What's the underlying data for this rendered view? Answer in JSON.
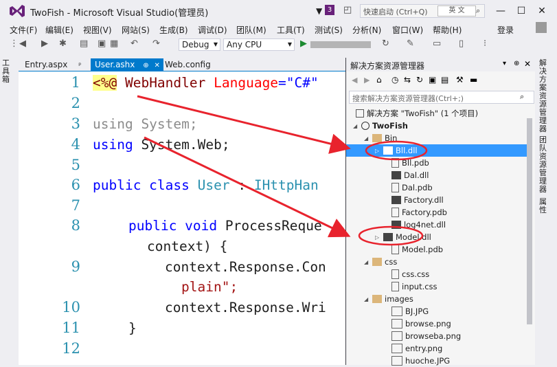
{
  "window": {
    "title": "TwoFish - Microsoft Visual Studio(管理员)",
    "notification_count": "3",
    "quick_launch_placeholder": "快速启动 (Ctrl+Q)",
    "ime_indicator": "英 文",
    "login_label": "登录"
  },
  "menu": [
    "文件(F)",
    "编辑(E)",
    "视图(V)",
    "网站(S)",
    "生成(B)",
    "调试(D)",
    "团队(M)",
    "工具(T)",
    "测试(S)",
    "分析(N)",
    "窗口(W)",
    "帮助(H)"
  ],
  "toolbar": {
    "configuration": "Debug",
    "platform": "Any CPU"
  },
  "toolbox_label": "工具箱",
  "editor": {
    "tabs": [
      {
        "label": "Entry.aspx",
        "pin": "ᵖ"
      },
      {
        "label": "User.ashx",
        "pin": "⊕",
        "close": "✕"
      },
      {
        "label": "Web.config"
      }
    ],
    "lines": [
      {
        "n": "1"
      },
      {
        "n": "2"
      },
      {
        "n": "3"
      },
      {
        "n": "4"
      },
      {
        "n": "5"
      },
      {
        "n": "6"
      },
      {
        "n": "7"
      },
      {
        "n": "8"
      },
      {
        "n": "9"
      },
      {
        "n": "10"
      },
      {
        "n": "11"
      },
      {
        "n": "12"
      }
    ],
    "code": {
      "l1_dir": "<%@",
      "l1_name": " WebHandler ",
      "l1_attr": "Language",
      "l1_eq": "=",
      "l1_val": "\"C#\"",
      "l3": "using System;",
      "l4a": "using",
      "l4b": " System.Web;",
      "l6a": "public class",
      "l6b": " User",
      "l6c": " : ",
      "l6d": "IHttpHan",
      "l8a": "public void",
      "l8b": " ProcessReque",
      "l8c": "context) {",
      "l9a": "context.Response.Con",
      "l9b": "plain\";",
      "l10": "context.Response.Wri",
      "l11": "}"
    }
  },
  "solution_explorer": {
    "title": "解决方案资源管理器",
    "search_placeholder": "搜索解决方案资源管理器(Ctrl+;)",
    "items": [
      {
        "label": "解决方案 \"TwoFish\" (1 个项目)"
      },
      {
        "label": "TwoFish"
      },
      {
        "label": "Bin"
      },
      {
        "label": "Bll.dll"
      },
      {
        "label": "Bll.pdb"
      },
      {
        "label": "Dal.dll"
      },
      {
        "label": "Dal.pdb"
      },
      {
        "label": "Factory.dll"
      },
      {
        "label": "Factory.pdb"
      },
      {
        "label": "log4net.dll"
      },
      {
        "label": "Model.dll"
      },
      {
        "label": "Model.pdb"
      },
      {
        "label": "css"
      },
      {
        "label": "css.css"
      },
      {
        "label": "input.css"
      },
      {
        "label": "images"
      },
      {
        "label": "BJ.JPG"
      },
      {
        "label": "browse.png"
      },
      {
        "label": "browseba.png"
      },
      {
        "label": "entry.png"
      },
      {
        "label": "huoche.JPG"
      }
    ]
  },
  "side_tabs": [
    "解决方案资源管理器",
    "团队资源管理器",
    "属性"
  ],
  "colors": {
    "accent": "#007ACC",
    "annotation_red": "#E8232D",
    "keyword": "#0000FF",
    "type": "#2B91AF",
    "vs_purple": "#68217A"
  }
}
